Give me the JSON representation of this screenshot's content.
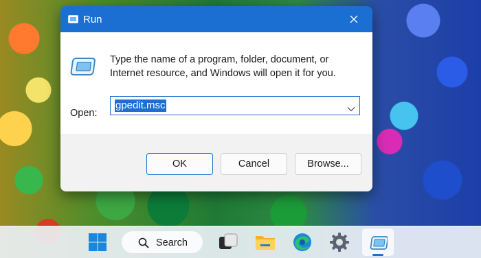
{
  "dialog": {
    "title": "Run",
    "close_label": "Close",
    "description": "Type the name of a program, folder, document, or Internet resource, and Windows will open it for you.",
    "open_label": "Open:",
    "open_value": "gpedit.msc",
    "buttons": {
      "ok": "OK",
      "cancel": "Cancel",
      "browse": "Browse..."
    }
  },
  "taskbar": {
    "search_label": "Search",
    "items": [
      "start-icon",
      "search-icon",
      "task-view-icon",
      "file-explorer-icon",
      "edge-icon",
      "settings-icon",
      "run-icon"
    ]
  },
  "colors": {
    "accent": "#1c6fd2",
    "selection": "#1f6fd0",
    "footer": "#f2f2f2"
  }
}
